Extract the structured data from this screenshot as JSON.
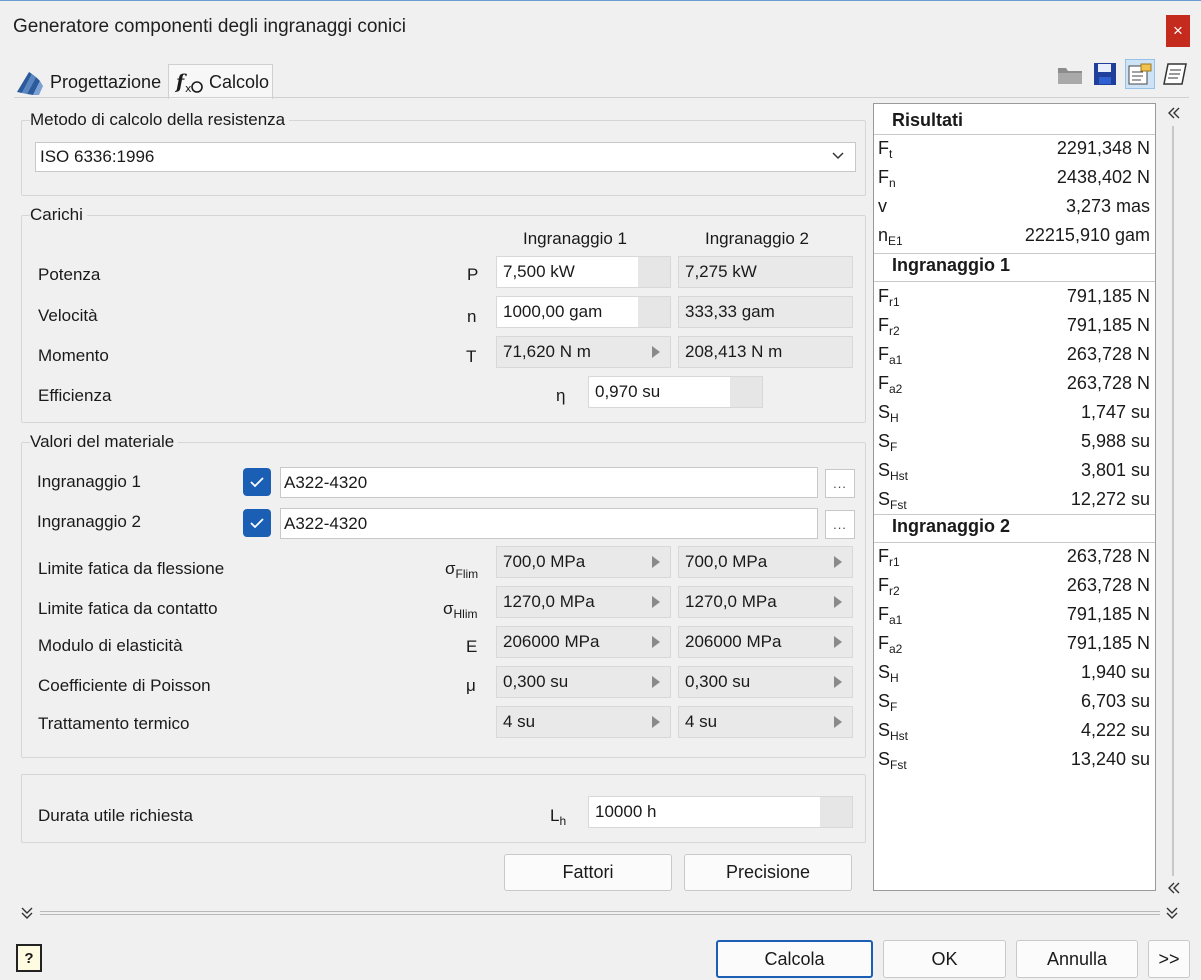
{
  "window": {
    "title": "Generatore componenti degli ingranaggi conici",
    "close_icon": "×"
  },
  "tabs": [
    {
      "label": "Progettazione",
      "icon": "gear-cone-icon"
    },
    {
      "label": "Calcolo",
      "icon": "fx-calc-icon"
    }
  ],
  "toolbar": {
    "icons": [
      "open-folder-icon",
      "save-icon",
      "properties-icon",
      "notes-icon"
    ]
  },
  "method": {
    "label": "Metodo di calcolo della resistenza",
    "value": "ISO 6336:1996"
  },
  "loads": {
    "label": "Carichi",
    "col1": "Ingranaggio 1",
    "col2": "Ingranaggio 2",
    "rows": [
      {
        "label": "Potenza",
        "symbol": "P",
        "v1": "7,500 kW",
        "v2": "7,275 kW"
      },
      {
        "label": "Velocità",
        "symbol": "n",
        "v1": "1000,00 gam",
        "v2": "333,33 gam"
      },
      {
        "label": "Momento",
        "symbol": "T",
        "v1": "71,620 N m",
        "v2": "208,413 N m"
      }
    ],
    "efficiency": {
      "label": "Efficienza",
      "symbol": "η",
      "value": "0,970 su"
    }
  },
  "material": {
    "label": "Valori del materiale",
    "gear1": {
      "label": "Ingranaggio 1",
      "value": "A322-4320",
      "checked": true
    },
    "gear2": {
      "label": "Ingranaggio 2",
      "value": "A322-4320",
      "checked": true
    },
    "browse": "...",
    "rows": [
      {
        "label": "Limite fatica da flessione",
        "sym": "σ",
        "sub": "Flim",
        "v1": "700,0 MPa",
        "v2": "700,0 MPa"
      },
      {
        "label": "Limite fatica da contatto",
        "sym": "σ",
        "sub": "Hlim",
        "v1": "1270,0 MPa",
        "v2": "1270,0 MPa"
      },
      {
        "label": "Modulo di elasticità",
        "sym": "E",
        "sub": "",
        "v1": "206000 MPa",
        "v2": "206000 MPa"
      },
      {
        "label": "Coefficiente di Poisson",
        "sym": "μ",
        "sub": "",
        "v1": "0,300 su",
        "v2": "0,300 su"
      },
      {
        "label": "Trattamento termico",
        "sym": "",
        "sub": "",
        "v1": "4 su",
        "v2": "4 su"
      }
    ]
  },
  "life": {
    "label": "Durata utile richiesta",
    "sym": "L",
    "sub": "h",
    "value": "10000 h"
  },
  "buttons": {
    "factors": "Fattori",
    "precision": "Precisione",
    "calculate": "Calcola",
    "ok": "OK",
    "cancel": "Annulla",
    "more": ">>",
    "help": "?"
  },
  "results": {
    "title": "Risultati",
    "general": [
      {
        "name": "F",
        "sub": "t",
        "value": "2291,348 N"
      },
      {
        "name": "F",
        "sub": "n",
        "value": "2438,402 N"
      },
      {
        "name": "v",
        "sub": "",
        "value": "3,273 mas"
      },
      {
        "name": "n",
        "sub": "E1",
        "value": "22215,910 gam"
      }
    ],
    "gear1_title": "Ingranaggio 1",
    "gear1": [
      {
        "name": "F",
        "sub": "r1",
        "value": "791,185 N"
      },
      {
        "name": "F",
        "sub": "r2",
        "value": "791,185 N"
      },
      {
        "name": "F",
        "sub": "a1",
        "value": "263,728 N"
      },
      {
        "name": "F",
        "sub": "a2",
        "value": "263,728 N"
      },
      {
        "name": "S",
        "sub": "H",
        "value": "1,747 su"
      },
      {
        "name": "S",
        "sub": "F",
        "value": "5,988 su"
      },
      {
        "name": "S",
        "sub": "Hst",
        "value": "3,801 su"
      },
      {
        "name": "S",
        "sub": "Fst",
        "value": "12,272 su"
      }
    ],
    "gear2_title": "Ingranaggio 2",
    "gear2": [
      {
        "name": "F",
        "sub": "r1",
        "value": "263,728 N"
      },
      {
        "name": "F",
        "sub": "r2",
        "value": "263,728 N"
      },
      {
        "name": "F",
        "sub": "a1",
        "value": "791,185 N"
      },
      {
        "name": "F",
        "sub": "a2",
        "value": "791,185 N"
      },
      {
        "name": "S",
        "sub": "H",
        "value": "1,940 su"
      },
      {
        "name": "S",
        "sub": "F",
        "value": "6,703 su"
      },
      {
        "name": "S",
        "sub": "Hst",
        "value": "4,222 su"
      },
      {
        "name": "S",
        "sub": "Fst",
        "value": "13,240 su"
      }
    ]
  }
}
